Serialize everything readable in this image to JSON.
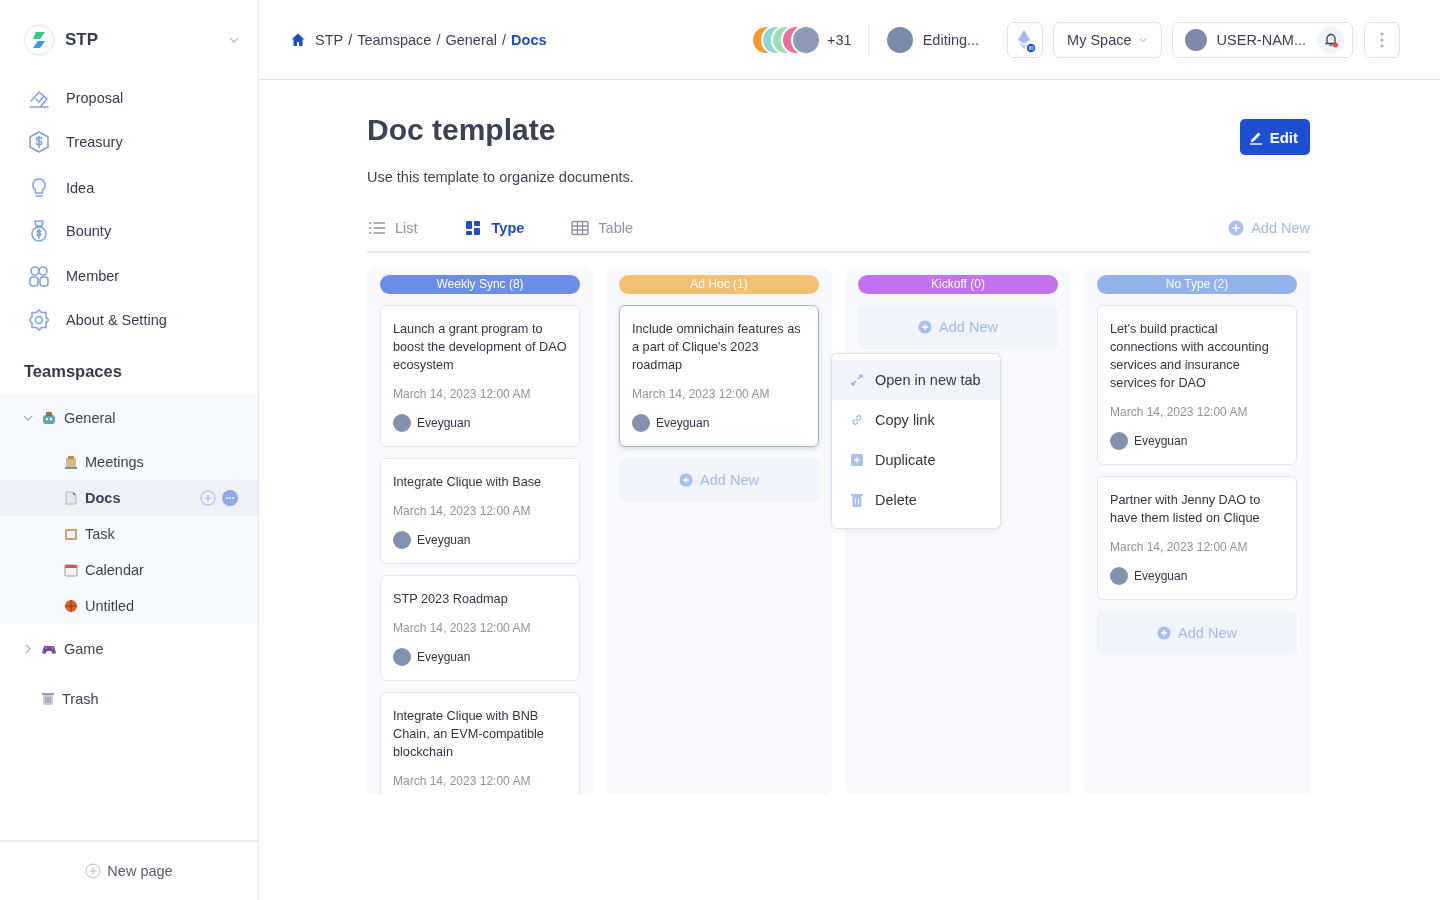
{
  "sidebar": {
    "workspace": "STP",
    "nav": [
      {
        "label": "Proposal"
      },
      {
        "label": "Treasury"
      },
      {
        "label": "Idea"
      },
      {
        "label": "Bounty"
      },
      {
        "label": "Member"
      },
      {
        "label": "About & Setting"
      }
    ],
    "section_title": "Teamspaces",
    "tree": [
      {
        "label": "General",
        "expanded": true,
        "selected": false,
        "children": [
          {
            "label": "Meetings",
            "selected": false
          },
          {
            "label": "Docs",
            "selected": true
          },
          {
            "label": "Task",
            "selected": false
          },
          {
            "label": "Calendar",
            "selected": false
          },
          {
            "label": "Untitled",
            "selected": false
          }
        ]
      },
      {
        "label": "Game",
        "expanded": false,
        "selected": false
      }
    ],
    "trash": "Trash",
    "new_page": "New page"
  },
  "header": {
    "breadcrumb": [
      "STP",
      "Teamspace",
      "General",
      "Docs"
    ],
    "separator": "/",
    "collaborators_more": "+31",
    "editing_status": "Editing...",
    "space": "My Space",
    "username": "USER-NAM...",
    "notification": true
  },
  "page": {
    "title": "Doc template",
    "description": "Use this template to organize documents.",
    "edit_button": "Edit",
    "views": [
      {
        "label": "List",
        "selected": false
      },
      {
        "label": "Type",
        "selected": true
      },
      {
        "label": "Table",
        "selected": false
      }
    ],
    "add_new": "Add New"
  },
  "columns": [
    {
      "title": "Weekly Sync (8)",
      "color": "#6e8de6",
      "cards": [
        {
          "title": "Launch a grant program to boost the development of DAO ecosystem",
          "date": "March 14, 2023 12:00 AM",
          "author": "Eveyguan",
          "highlighted": false
        },
        {
          "title": "Integrate Clique with Base",
          "date": "March 14, 2023 12:00 AM",
          "author": "Eveyguan",
          "highlighted": false
        },
        {
          "title": "STP 2023 Roadmap",
          "date": "March 14, 2023 12:00 AM",
          "author": "Eveyguan",
          "highlighted": false
        },
        {
          "title": "Integrate Clique with BNB Chain, an EVM-compatible blockchain",
          "date": "March 14, 2023 12:00 AM",
          "highlighted": false
        }
      ]
    },
    {
      "title": "Ad Hoc (1)",
      "color": "#f3c073",
      "cards": [
        {
          "title": "Include omnichain features as a part of Clique's 2023 roadmap",
          "date": "March 14, 2023 12:00 AM",
          "author": "Eveyguan",
          "highlighted": true
        }
      ],
      "add_new": "Add New"
    },
    {
      "title": "Kickoff (0)",
      "color": "#c272f0",
      "add_new": "Add New"
    },
    {
      "title": "No Type (2)",
      "color": "#92b2ec",
      "cards": [
        {
          "title": "Let's build practical connections with accounting services and insurance services for DAO",
          "date": "March 14, 2023 12:00 AM",
          "author": "Eveyguan",
          "highlighted": false
        },
        {
          "title": "Partner with Jenny DAO to have them listed on Clique",
          "date": "March 14, 2023 12:00 AM",
          "author": "Eveyguan",
          "highlighted": false
        }
      ],
      "add_new": "Add New"
    }
  ],
  "context_menu": [
    {
      "label": "Open in new tab",
      "selected": true
    },
    {
      "label": "Copy link",
      "selected": false
    },
    {
      "label": "Duplicate",
      "selected": false
    },
    {
      "label": "Delete",
      "selected": false
    }
  ]
}
